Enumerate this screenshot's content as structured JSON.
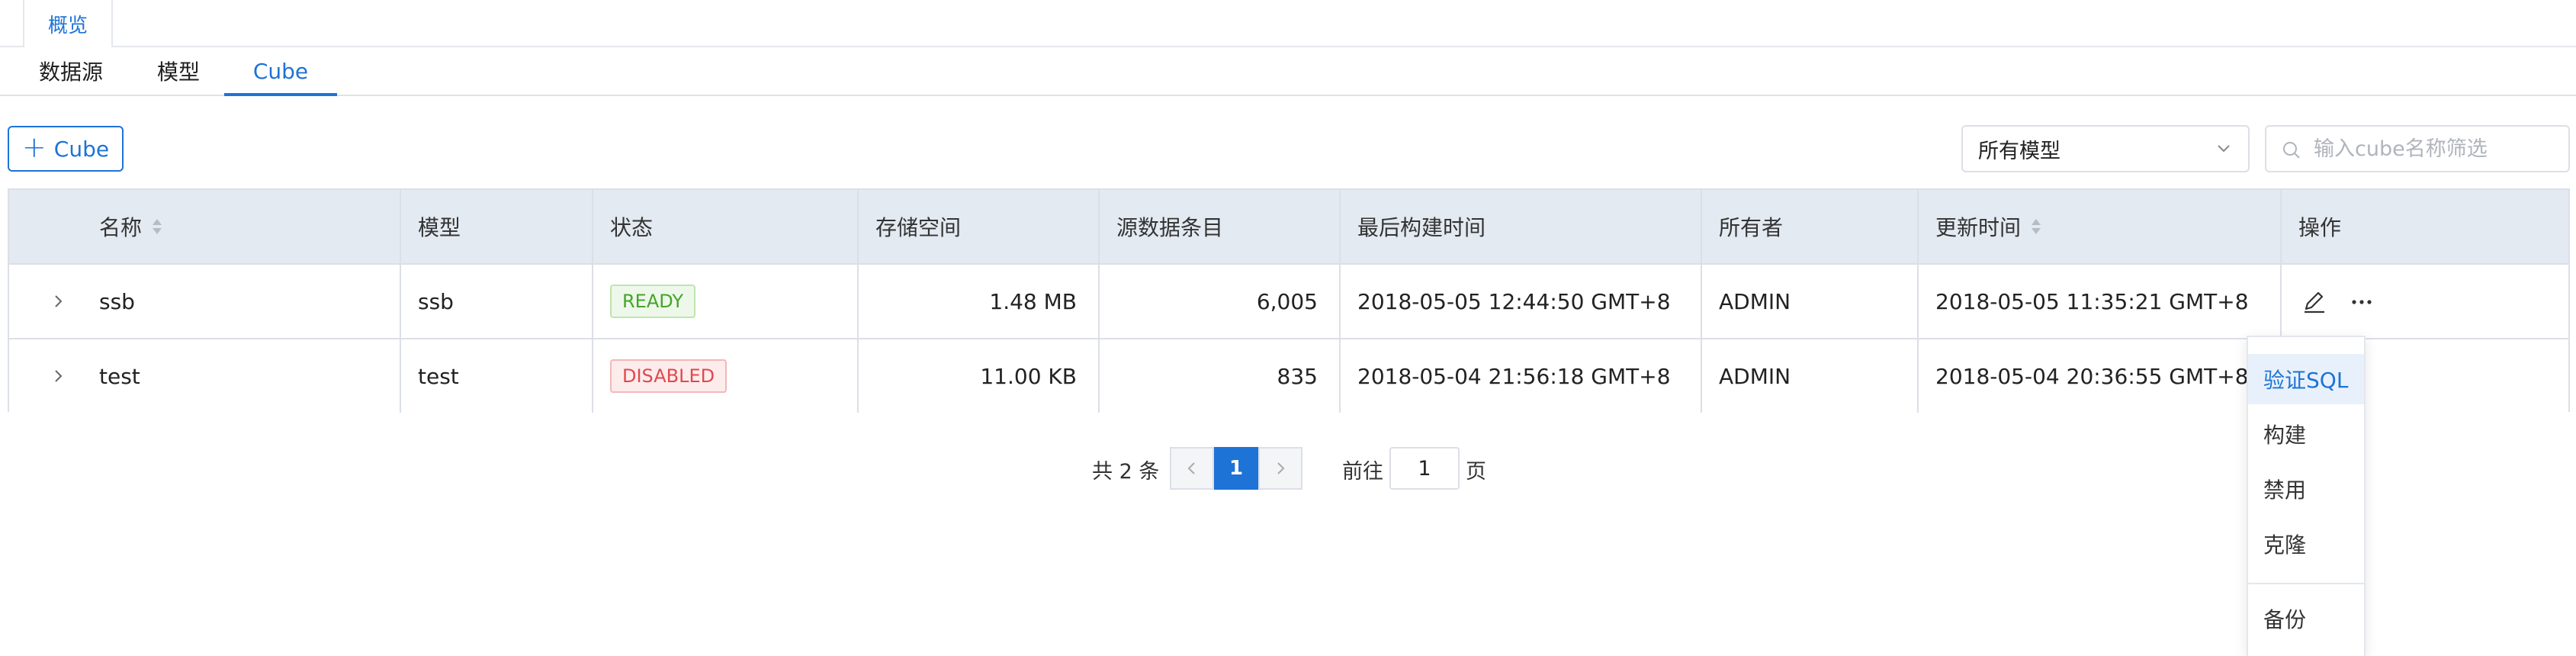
{
  "top_tab": {
    "label": "概览"
  },
  "sub_tabs": [
    {
      "label": "数据源"
    },
    {
      "label": "模型"
    },
    {
      "label": "Cube"
    }
  ],
  "toolbar": {
    "add_label": "Cube",
    "model_select_value": "所有模型",
    "search_placeholder": "输入cube名称筛选"
  },
  "table": {
    "columns": [
      "名称",
      "模型",
      "状态",
      "存储空间",
      "源数据条目",
      "最后构建时间",
      "所有者",
      "更新时间",
      "操作"
    ],
    "rows": [
      {
        "name": "ssb",
        "model": "ssb",
        "status": "READY",
        "storage": "1.48 MB",
        "source_records": "6,005",
        "last_build": "2018-05-05 12:44:50 GMT+8",
        "owner": "ADMIN",
        "updated": "2018-05-05 11:35:21 GMT+8"
      },
      {
        "name": "test",
        "model": "test",
        "status": "DISABLED",
        "storage": "11.00 KB",
        "source_records": "835",
        "last_build": "2018-05-04 21:56:18 GMT+8",
        "owner": "ADMIN",
        "updated": "2018-05-04 20:36:55 GMT+8"
      }
    ]
  },
  "action_menu": {
    "items": [
      "验证SQL",
      "构建",
      "禁用",
      "克隆",
      "备份"
    ],
    "highlighted": "验证SQL"
  },
  "pagination": {
    "total_text": "共 2 条",
    "current_page": "1",
    "goto_label": "前往",
    "goto_value": "1",
    "goto_unit": "页"
  },
  "colors": {
    "accent": "#1e73d6",
    "header_bg": "#e3eaf1",
    "ready_green": "#45a52a",
    "disabled_red": "#e0484d"
  },
  "icons": {
    "add": "plus-icon",
    "select": "chevron-down-icon",
    "search": "search-icon",
    "sort": "sort-icon",
    "expand": "chevron-right-icon",
    "edit": "pencil-icon",
    "more": "more-icon",
    "prev": "chevron-left-icon",
    "next": "chevron-right-icon"
  }
}
